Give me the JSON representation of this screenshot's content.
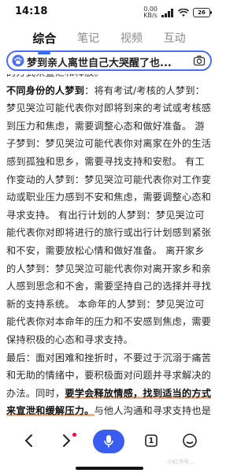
{
  "status_bar": {
    "time": "14:18",
    "net_speed_top": "0.00",
    "net_speed_bottom": "KB/s",
    "battery": "26"
  },
  "tabs": [
    {
      "label": "综合",
      "active": true
    },
    {
      "label": "笔记",
      "active": false
    },
    {
      "label": "视频",
      "active": false
    },
    {
      "label": "互动",
      "active": false
    }
  ],
  "search": {
    "query": "梦到亲人离世自己大哭醒了也..."
  },
  "content": {
    "partial_line": "的方式来宣泄和释放。",
    "p1_bold": "不同身份的人梦到",
    "p1_text": "：将有考试/考核的人梦到：梦见哭泣可能代表你对即将到来的考试或考核感到压力和焦虑，需要调整心态和做好准备。 游子梦到：梦见哭泣可能代表你对离家在外的生活感到孤独和思乡，需要寻找支持和安慰。 有工作变动的人梦到：梦见哭泣可能代表你对工作变动或职业压力感到不安和焦虑，需要调整心态和寻求支持。 有出行计划的人梦到：梦见哭泣可能代表你对即将进行的旅行或出行计划感到紧张和不安，需要放松心情和做好准备。 离开家乡的人梦到：梦见哭泣可能代表你对离开家乡和亲人感到思念和不舍，需要坚持自己的选择并寻找新的支持系统。 本命年的人梦到：梦见哭泣可能代表你对本命年的压力和不安感到焦虑，需要保持积极的心态和寻求支持。",
    "p2_text": "最后：面对困难和挫折时，不要过于沉溺于痛苦和无助的情绪中，要积极面对问题并寻求解决的办法。同时，",
    "p2_highlight": "要学会释放情感，找到适当的方式来宣泄和缓解压力。",
    "p2_tail": "与他人沟通和寻求支持也是重要的，他们可以给予你帮助和鼓"
  },
  "bottom_nav": {
    "page_count": "1",
    "watermark": "小红书号..."
  },
  "colors": {
    "accent": "#3a5cf0",
    "highlight_underline": "#f2b183"
  }
}
